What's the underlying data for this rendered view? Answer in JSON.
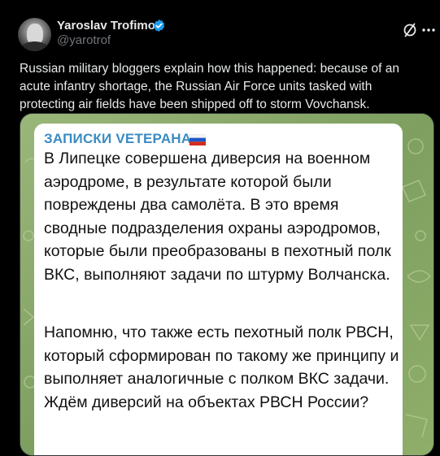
{
  "author": {
    "name": "Yaroslav Trofimov",
    "handle": "@yarotrof",
    "verified": true,
    "avatar_icon": "profile-photo"
  },
  "actions": {
    "grok_icon": "grok-slash-icon",
    "more_icon": "more-dots-icon"
  },
  "tweet": {
    "text": "Russian military bloggers explain how this happened: because of an acute infantry shortage, the Russian Air Force units tasked with protecting air fields have been shipped off to storm Vovchansk."
  },
  "media": {
    "channel_name": "ЗАПИСКИ VETEPAHA",
    "flag": "russian-flag-icon",
    "paragraph_1": "В Липецке совершена диверсия на военном аэродроме, в результате которой были повреждены два самолёта. В это время сводные подразделения охраны аэродромов, которые были преобразованы в пехотный полк ВКС, выполняют задачи по штурму Волчанска.",
    "paragraph_2": "Напомню, что также есть пехотный полк РВСН, который сформирован по такому же принципу и выполняет аналогичные с полком ВКС задачи. Ждём диверсий на объектах РВСН России?"
  },
  "colors": {
    "background": "#000000",
    "text": "#e7e9ea",
    "secondary": "#71767b",
    "verified": "#1d9bf0",
    "channel": "#3b8bc2",
    "media_bg": "#86a66a"
  }
}
